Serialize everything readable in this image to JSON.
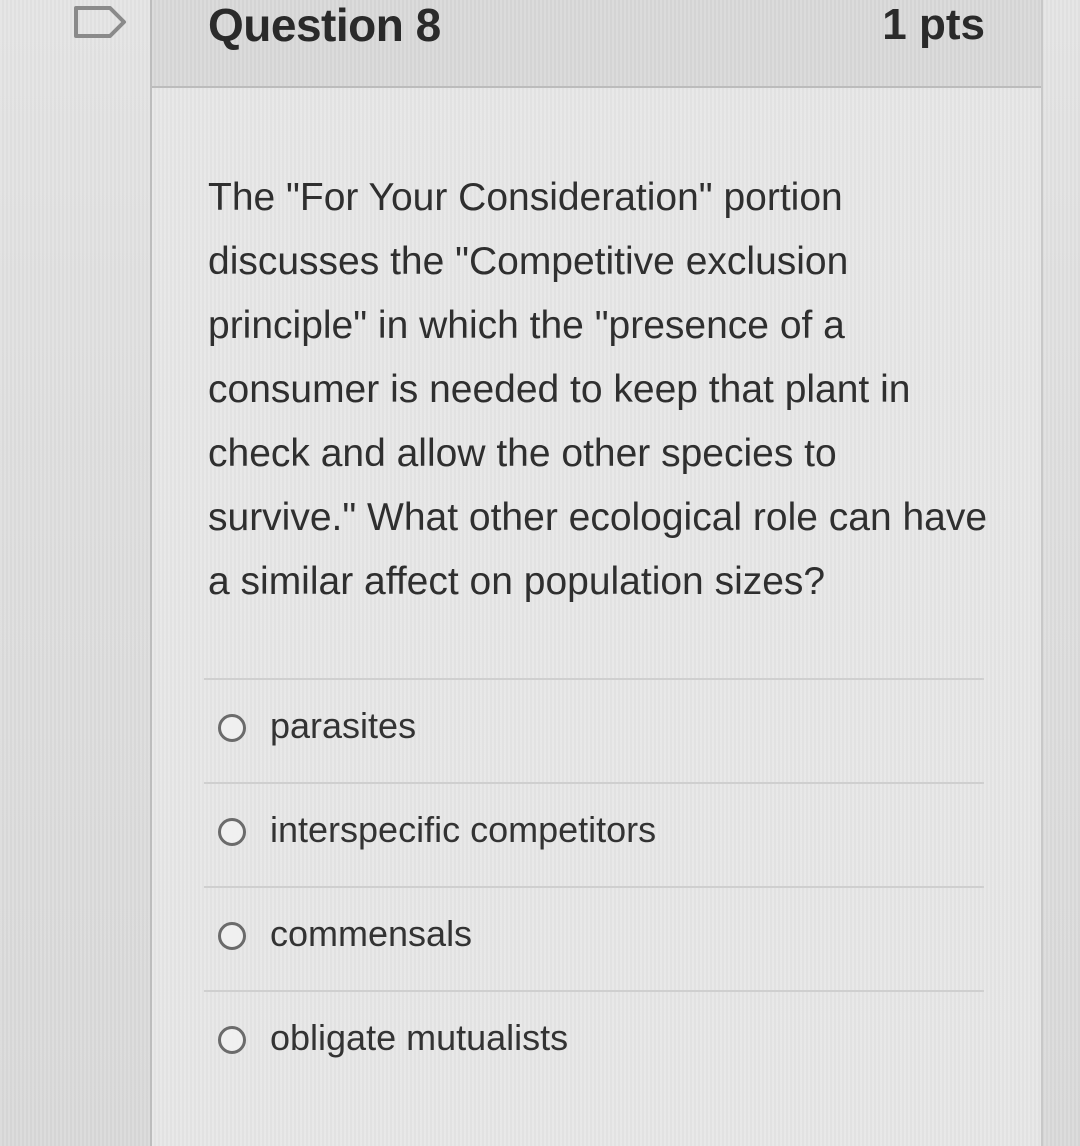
{
  "question": {
    "title": "Question 8",
    "points": "1 pts",
    "text": "The \"For Your Consideration\" portion discusses the \"Competitive exclusion principle\" in which the \"presence of a consumer is needed to keep that plant in check and allow the other species to survive.\" What other ecological role can have a similar affect on population sizes?",
    "flag_icon": "flag-icon",
    "answers": [
      {
        "label": "parasites",
        "selected": false
      },
      {
        "label": "interspecific competitors",
        "selected": false
      },
      {
        "label": "commensals",
        "selected": false
      },
      {
        "label": "obligate mutualists",
        "selected": false
      }
    ]
  },
  "colors": {
    "text": "#2f2f2f",
    "border": "#bcbcbc",
    "radio_border": "#6b6b6b"
  }
}
